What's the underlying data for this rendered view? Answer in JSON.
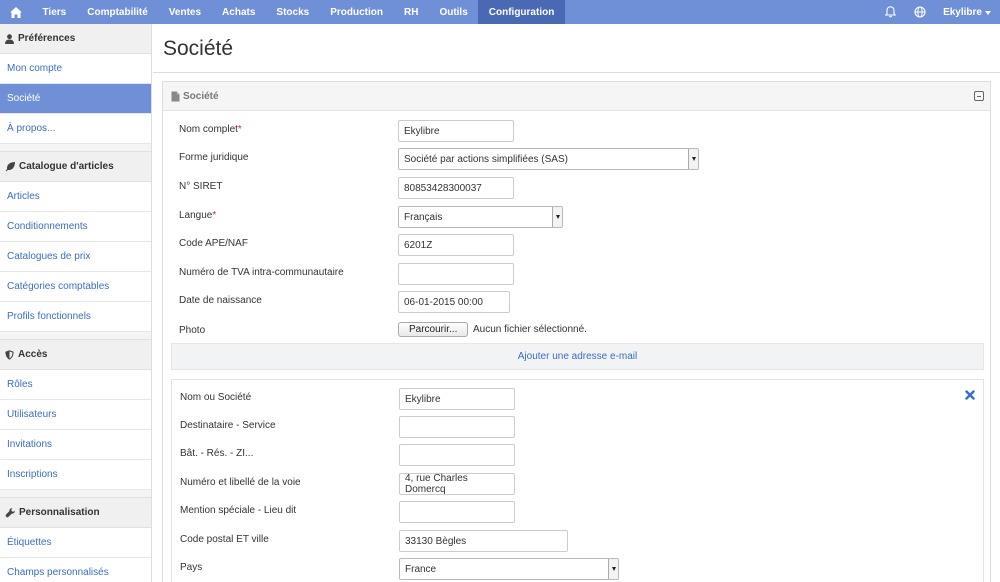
{
  "nav": {
    "home_icon": "home-icon",
    "items": [
      "Tiers",
      "Comptabilité",
      "Ventes",
      "Achats",
      "Stocks",
      "Production",
      "RH",
      "Outils",
      "Configuration"
    ],
    "active_index": 8,
    "bell_icon": "bell-icon",
    "globe_icon": "globe-icon",
    "user": "Ekylibre"
  },
  "sidebar": {
    "sections": [
      {
        "title": "Préférences",
        "icon": "user-icon",
        "items": [
          "Mon compte",
          "Société",
          "À propos..."
        ]
      },
      {
        "title": "Catalogue d'articles",
        "icon": "leaf-icon",
        "items": [
          "Articles",
          "Conditionnements",
          "Catalogues de prix",
          "Catégories comptables",
          "Profils fonctionnels"
        ]
      },
      {
        "title": "Accès",
        "icon": "shield-icon",
        "items": [
          "Rôles",
          "Utilisateurs",
          "Invitations",
          "Inscriptions"
        ]
      },
      {
        "title": "Personnalisation",
        "icon": "wrench-icon",
        "items": [
          "Étiquettes",
          "Champs personnalisés"
        ]
      }
    ],
    "active_item": "Société"
  },
  "page": {
    "title": "Société",
    "panel_title": "Société"
  },
  "form": {
    "nom_complet": {
      "label": "Nom complet",
      "required": "*",
      "value": "Ekylibre"
    },
    "forme_juridique": {
      "label": "Forme juridique",
      "value": "Société par actions simplifiées (SAS)"
    },
    "siret": {
      "label": "N° SIRET",
      "value": "80853428300037"
    },
    "langue": {
      "label": "Langue",
      "required": "*",
      "value": "Français"
    },
    "ape": {
      "label": "Code APE/NAF",
      "value": "6201Z"
    },
    "tva": {
      "label": "Numéro de TVA intra-communautaire",
      "value": ""
    },
    "naissance": {
      "label": "Date de naissance",
      "value": "06-01-2015 00:00"
    },
    "photo": {
      "label": "Photo",
      "button": "Parcourir...",
      "status": "Aucun fichier sélectionné."
    },
    "add_email": "Ajouter une adresse e-mail"
  },
  "address": {
    "nom": {
      "label": "Nom ou Société",
      "value": "Ekylibre"
    },
    "destinataire": {
      "label": "Destinataire - Service",
      "value": ""
    },
    "batiment": {
      "label": "Bât. - Rés. - ZI...",
      "value": ""
    },
    "voie": {
      "label": "Numéro et libellé de la voie",
      "value": "4, rue Charles Domercq"
    },
    "mention": {
      "label": "Mention spéciale - Lieu dit",
      "value": ""
    },
    "code_postal": {
      "label": "Code postal ET ville",
      "value": "33130 Bègles"
    },
    "pays": {
      "label": "Pays",
      "value": "France"
    }
  },
  "colors": {
    "nav_bg": "#6f8fd6",
    "nav_active": "#4a69b5",
    "link": "#3a6ec2"
  }
}
